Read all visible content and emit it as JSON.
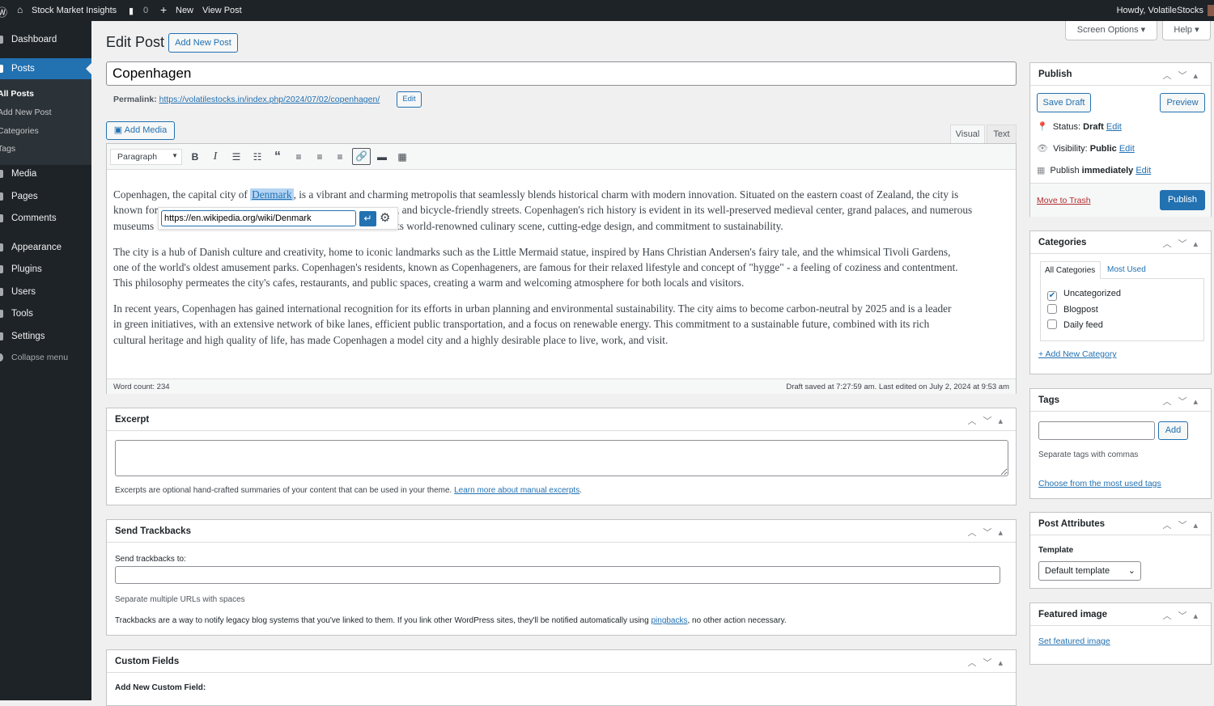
{
  "adminbar": {
    "site": "Stock Market Insights",
    "comments": "0",
    "new": "New",
    "view": "View Post",
    "howdy": "Howdy, VolatileStocks"
  },
  "sidebar": {
    "dashboard": "Dashboard",
    "posts": "Posts",
    "sub": [
      "All Posts",
      "Add New Post",
      "Categories",
      "Tags"
    ],
    "items": [
      "Media",
      "Pages",
      "Comments",
      "Appearance",
      "Plugins",
      "Users",
      "Tools",
      "Settings"
    ],
    "collapse": "Collapse menu"
  },
  "header": {
    "title": "Edit Post",
    "add_new": "Add New Post",
    "screen_options": "Screen Options",
    "help": "Help"
  },
  "post": {
    "title": "Copenhagen",
    "permalink_label": "Permalink:",
    "permalink": "https://volatilestocks.in/index.php/2024/07/02/copenhagen/",
    "permalink_edit": "Edit"
  },
  "editor": {
    "add_media": "Add Media",
    "tab_visual": "Visual",
    "tab_text": "Text",
    "format": "Paragraph",
    "p1": {
      "l1a": "Copenhagen, the capital city of ",
      "link": "Denmark",
      "l1b": ", is a vibrant and charming metropolis that seamlessly blends historical charm with modern innovation. Situated on the eastern coast of Zealand, the city is",
      "l2a": "known for",
      "l2b": ", and bicycle-friendly streets. Copenhagen's rich history is evident in its well-preserved medieval center, grand palaces, and numerous",
      "l3a": "museums",
      "l3b": "ts world-renowned culinary scene, cutting-edge design, and commitment to sustainability."
    },
    "p2": [
      "The city is a hub of Danish culture and creativity, home to iconic landmarks such as the Little Mermaid statue, inspired by Hans Christian Andersen's fairy tale, and the whimsical Tivoli Gardens,",
      "one of the world's oldest amusement parks. Copenhagen's residents, known as Copenhageners, are famous for their relaxed lifestyle and concept of \"hygge\" - a feeling of coziness and contentment.",
      "This philosophy permeates the city's cafes, restaurants, and public spaces, creating a warm and welcoming atmosphere for both locals and visitors."
    ],
    "p3": [
      "In recent years, Copenhagen has gained international recognition for its efforts in urban planning and environmental sustainability. The city aims to become carbon-neutral by 2025 and is a leader",
      "in green initiatives, with an extensive network of bike lanes, efficient public transportation, and a focus on renewable energy. This commitment to a sustainable future, combined with its rich",
      "cultural heritage and high quality of life, has made Copenhagen a model city and a highly desirable place to live, work, and visit."
    ],
    "link_url": "https://en.wikipedia.org/wiki/Denmark",
    "word_count": "Word count: 234",
    "saved": "Draft saved at 7:27:59 am. Last edited on July 2, 2024 at 9:53 am"
  },
  "excerpt": {
    "title": "Excerpt",
    "help": "Excerpts are optional hand-crafted summaries of your content that can be used in your theme.",
    "link": "Learn more about manual excerpts"
  },
  "trackbacks": {
    "title": "Send Trackbacks",
    "label": "Send trackbacks to:",
    "hint": "Separate multiple URLs with spaces",
    "info_a": "Trackbacks are a way to notify legacy blog systems that you've linked to them. If you link other WordPress sites, they'll be notified automatically using ",
    "info_link": "pingbacks",
    "info_b": ", no other action necessary."
  },
  "custom_fields": {
    "title": "Custom Fields",
    "add_label": "Add New Custom Field:"
  },
  "publish": {
    "title": "Publish",
    "save_draft": "Save Draft",
    "preview": "Preview",
    "status_label": "Status:",
    "status": "Draft",
    "visibility_label": "Visibility:",
    "visibility": "Public",
    "publish_label": "Publish",
    "publish_when": "immediately",
    "edit": "Edit",
    "trash": "Move to Trash",
    "publish_btn": "Publish"
  },
  "categories": {
    "title": "Categories",
    "tab_all": "All Categories",
    "tab_most": "Most Used",
    "items": [
      {
        "label": "Uncategorized",
        "checked": true
      },
      {
        "label": "Blogpost",
        "checked": false
      },
      {
        "label": "Daily feed",
        "checked": false
      }
    ],
    "add": "+ Add New Category"
  },
  "tags": {
    "title": "Tags",
    "add": "Add",
    "hint": "Separate tags with commas",
    "choose": "Choose from the most used tags"
  },
  "attributes": {
    "title": "Post Attributes",
    "template_label": "Template",
    "template": "Default template"
  },
  "featured": {
    "title": "Featured image",
    "set": "Set featured image"
  }
}
